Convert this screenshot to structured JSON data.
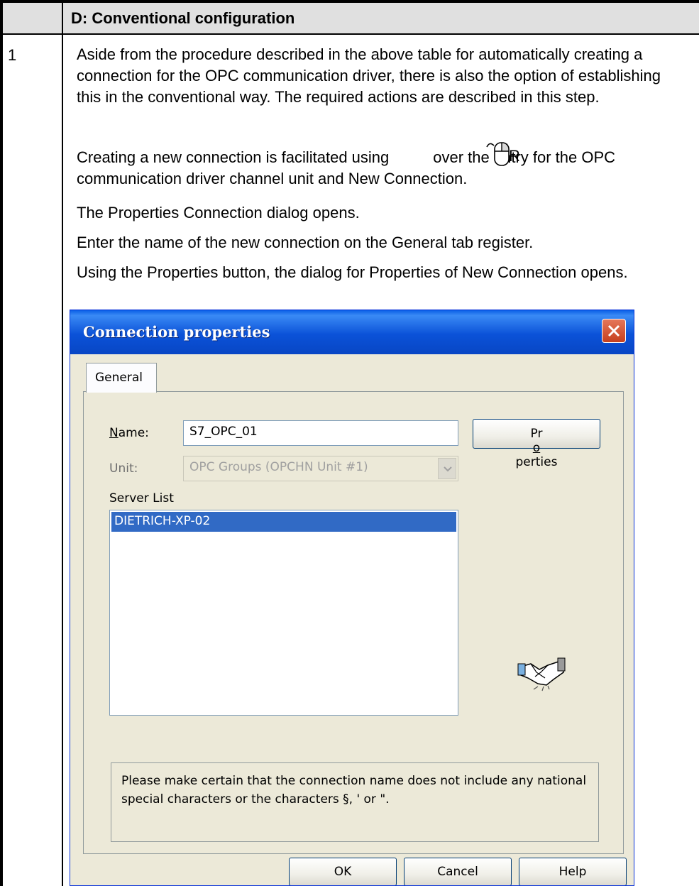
{
  "table": {
    "header_title": "D: Conventional configuration",
    "step_number": "1",
    "paragraphs": {
      "p1": "Aside from the procedure described in the above table for automatically creating a connection for the OPC communication driver, there is also the option of establishing this in the conventional way. The required actions are described in this step.",
      "p2_before_icon": "Creating a new connection is facilitated using",
      "p2_icon_suffix": "R",
      "p2_after_icon": "over the entry for the OPC communication driver channel unit and New Connection.",
      "p3": "The Properties Connection dialog opens.",
      "p4": "Enter the name of the new connection on the General tab register.",
      "p5": "Using the Properties button, the dialog for Properties of New Connection opens."
    }
  },
  "dialog": {
    "title": "Connection properties",
    "tab_general": "General",
    "name_label_mnemonic": "N",
    "name_label_rest": "ame:",
    "name_value": "S7_OPC_01",
    "unit_label": "Unit:",
    "unit_value": "OPC Groups (OPCHN Unit #1)",
    "server_list_label": "Server List",
    "server_list_items": [
      "DIETRICH-XP-02"
    ],
    "properties_button_pre": "Pr",
    "properties_button_mnemonic": "o",
    "properties_button_post": "perties",
    "note": "Please make certain that the connection name does not include any national special characters or the characters §, ' or \".",
    "ok_label": "OK",
    "cancel_label": "Cancel",
    "help_label": "Help"
  },
  "colors": {
    "titlebar": "#0b52d8",
    "selection": "#316ac5",
    "dialog_bg": "#ece9d8",
    "close_button": "#d8573a"
  },
  "icons": {
    "mouse": "mouse-right-click-icon",
    "close": "close-icon",
    "dropdown": "chevron-down-icon",
    "handshake": "handshake-icon"
  }
}
